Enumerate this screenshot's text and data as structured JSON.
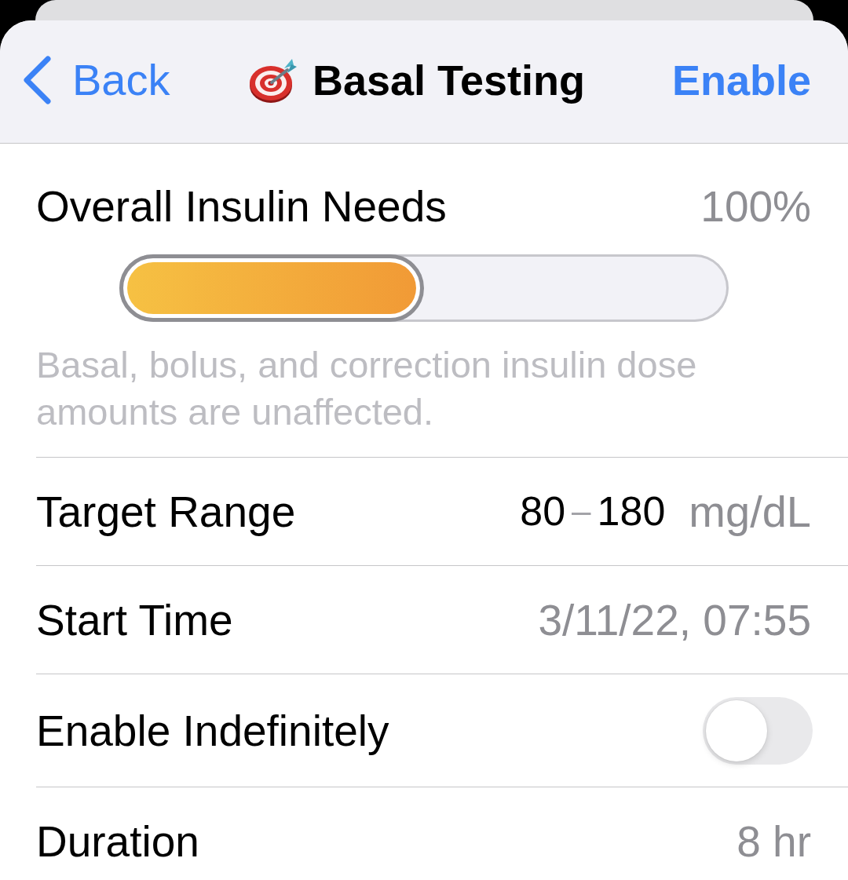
{
  "nav_bar": {
    "back_label": "Back",
    "title": "Basal Testing",
    "action": "Enable"
  },
  "rows": [
    {
      "kind": "slider",
      "label": "Overall Insulin Needs",
      "value": "100%",
      "level": 0.5,
      "footnote": "Basal, bolus, and correction insulin dose amounts are unaffected."
    },
    {
      "kind": "range",
      "label": "Target Range",
      "low": "80",
      "separator": "–",
      "high": "180",
      "unit": "mg/dL"
    },
    {
      "kind": "value",
      "label": "Start Time",
      "value": "3/11/22, 07:55"
    },
    {
      "kind": "toggle",
      "label": "Enable Indefinitely",
      "on": false
    },
    {
      "kind": "value",
      "label": "Duration",
      "value": "8 hr"
    }
  ]
}
